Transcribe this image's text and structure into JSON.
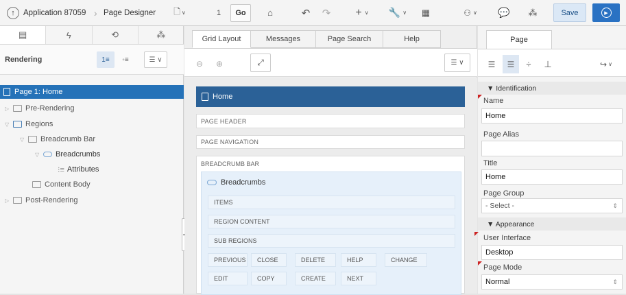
{
  "topbar": {
    "app_label": "Application 87059",
    "page_designer_label": "Page Designer",
    "page_number": "1",
    "go_label": "Go",
    "save_label": "Save"
  },
  "left": {
    "tabs": [
      "rendering-tab",
      "dynamic-actions-tab",
      "processing-tab",
      "shared-components-tab"
    ],
    "header_title": "Rendering",
    "tree": [
      {
        "label": "Page 1: Home"
      },
      {
        "label": "Pre-Rendering"
      },
      {
        "label": "Regions"
      },
      {
        "label": "Breadcrumb Bar"
      },
      {
        "label": "Breadcrumbs"
      },
      {
        "label": "Attributes"
      },
      {
        "label": "Content Body"
      },
      {
        "label": "Post-Rendering"
      }
    ]
  },
  "center": {
    "tabs": [
      "Grid Layout",
      "Messages",
      "Page Search",
      "Help"
    ],
    "home_label": "Home",
    "page_header": "PAGE HEADER",
    "page_navigation": "PAGE NAVIGATION",
    "breadcrumb_bar": "BREADCRUMB BAR",
    "breadcrumbs_region": "Breadcrumbs",
    "slots": [
      "ITEMS",
      "REGION CONTENT",
      "SUB REGIONS"
    ],
    "buttons_row1": [
      "PREVIOUS",
      "CLOSE",
      "DELETE",
      "HELP",
      "CHANGE"
    ],
    "buttons_row2": [
      "EDIT",
      "COPY",
      "CREATE",
      "NEXT"
    ]
  },
  "right": {
    "tab": "Page",
    "identification": "▼ Identification",
    "name_label": "Name",
    "name_value": "Home",
    "alias_label": "Page Alias",
    "alias_value": "",
    "title_label": "Title",
    "title_value": "Home",
    "group_label": "Page Group",
    "group_value": "- Select -",
    "appearance": "▼ Appearance",
    "ui_label": "User Interface",
    "ui_value": "Desktop",
    "mode_label": "Page Mode",
    "mode_value": "Normal"
  },
  "colors": {
    "accent": "#2572b8",
    "home_bar": "#2b6197",
    "required_marker": "#cc2222"
  }
}
